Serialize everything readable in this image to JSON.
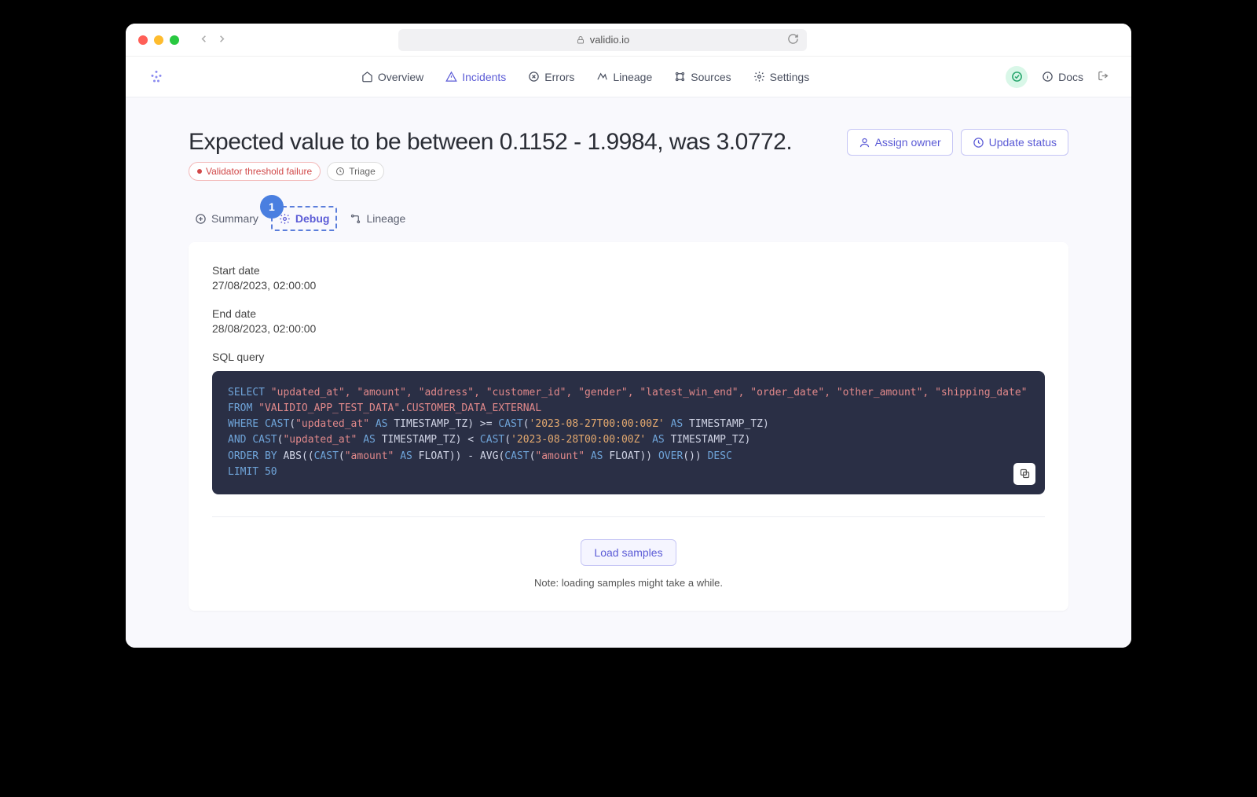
{
  "browser": {
    "url": "validio.io"
  },
  "nav": {
    "items": {
      "overview": "Overview",
      "incidents": "Incidents",
      "errors": "Errors",
      "lineage": "Lineage",
      "sources": "Sources",
      "settings": "Settings"
    },
    "docs": "Docs"
  },
  "page": {
    "title": "Expected value to be between 0.1152 - 1.9984, was 3.0772.",
    "badge1": "Validator threshold failure",
    "badge2": "Triage",
    "actions": {
      "assign": "Assign owner",
      "update": "Update status"
    }
  },
  "tabs": {
    "summary": "Summary",
    "debug": "Debug",
    "lineage": "Lineage",
    "callout": "1"
  },
  "debug": {
    "start_label": "Start date",
    "start_value": "27/08/2023, 02:00:00",
    "end_label": "End date",
    "end_value": "28/08/2023, 02:00:00",
    "sql_label": "SQL query",
    "sql_tokens": {
      "select": "SELECT",
      "cols": "\"updated_at\", \"amount\", \"address\", \"customer_id\", \"gender\", \"latest_win_end\", \"order_date\", \"other_amount\", \"shipping_date\"",
      "from": "FROM",
      "schema": "\"VALIDIO_APP_TEST_DATA\"",
      "dot": ".",
      "table": "CUSTOMER_DATA_EXTERNAL",
      "where": "WHERE",
      "cast": "CAST",
      "col_upd": "\"updated_at\"",
      "as": "AS",
      "tstz": "TIMESTAMP_TZ",
      "gte": ">=",
      "ts1": "'2023-08-27T00:00:00Z'",
      "and": "AND",
      "lt": "<",
      "ts2": "'2023-08-28T00:00:00Z'",
      "orderby": "ORDER BY",
      "abs": "ABS",
      "col_amt": "\"amount\"",
      "float": "FLOAT",
      "minus": "-",
      "avg": "AVG",
      "over": "OVER",
      "desc": "DESC",
      "limit": "LIMIT",
      "fifty": "50"
    },
    "load_button": "Load samples",
    "note": "Note: loading samples might take a while."
  }
}
